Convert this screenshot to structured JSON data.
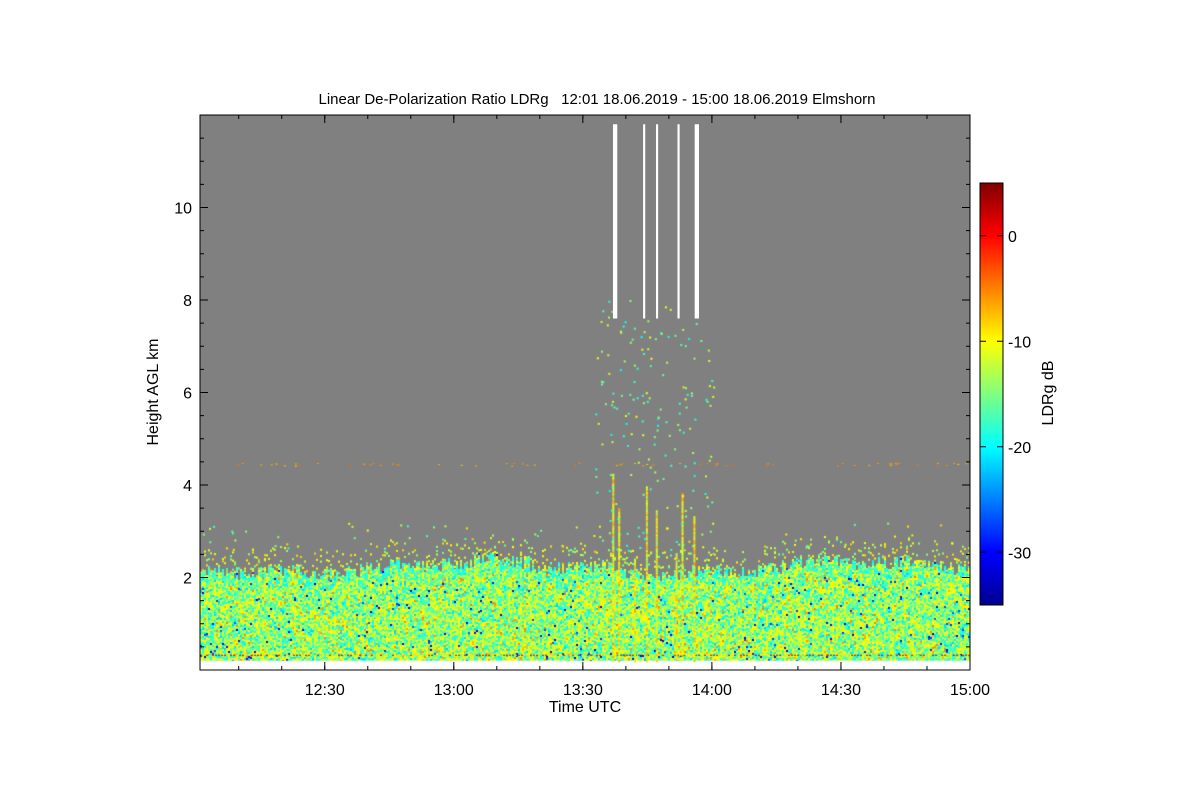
{
  "chart_data": {
    "type": "heatmap",
    "title": "Linear De-Polarization Ratio LDRg   12:01 18.06.2019 - 15:00 18.06.2019 Elmshorn",
    "xlabel": "Time UTC",
    "ylabel": "Height AGL km",
    "xlim": [
      "12:01",
      "15:00"
    ],
    "ylim": [
      0,
      12
    ],
    "x_ticks": [
      "12:30",
      "13:00",
      "13:30",
      "14:00",
      "14:30",
      "15:00"
    ],
    "y_ticks": [
      2,
      4,
      6,
      8,
      10
    ],
    "colorbar": {
      "label": "LDRg dB",
      "range": [
        -35,
        5
      ],
      "ticks": [
        0,
        -10,
        -20,
        -30
      ],
      "colormap": "jet"
    },
    "background_color": "#808080",
    "no_signal_color": "#ffffff",
    "description_layers": [
      {
        "name": "boundary-layer",
        "height_range_km": [
          0.2,
          2.6
        ],
        "typical_ldr_db": [
          -20,
          -8
        ]
      },
      {
        "name": "insect-streaks",
        "time_range": [
          "13:35",
          "13:58"
        ],
        "height_range_km": [
          0.2,
          4.4
        ]
      }
    ],
    "white_gaps": [
      {
        "time_range": [
          "13:37",
          "13:39"
        ],
        "height_range_km": [
          7.6,
          11.8
        ]
      },
      {
        "time_range": [
          "13:44",
          "13:45"
        ],
        "height_range_km": [
          7.6,
          11.8
        ]
      },
      {
        "time_range": [
          "13:47",
          "13:48"
        ],
        "height_range_km": [
          7.6,
          11.8
        ]
      },
      {
        "time_range": [
          "13:52",
          "13:53"
        ],
        "height_range_km": [
          7.6,
          11.8
        ]
      },
      {
        "time_range": [
          "13:56",
          "13:58"
        ],
        "height_range_km": [
          7.6,
          11.8
        ]
      }
    ]
  }
}
